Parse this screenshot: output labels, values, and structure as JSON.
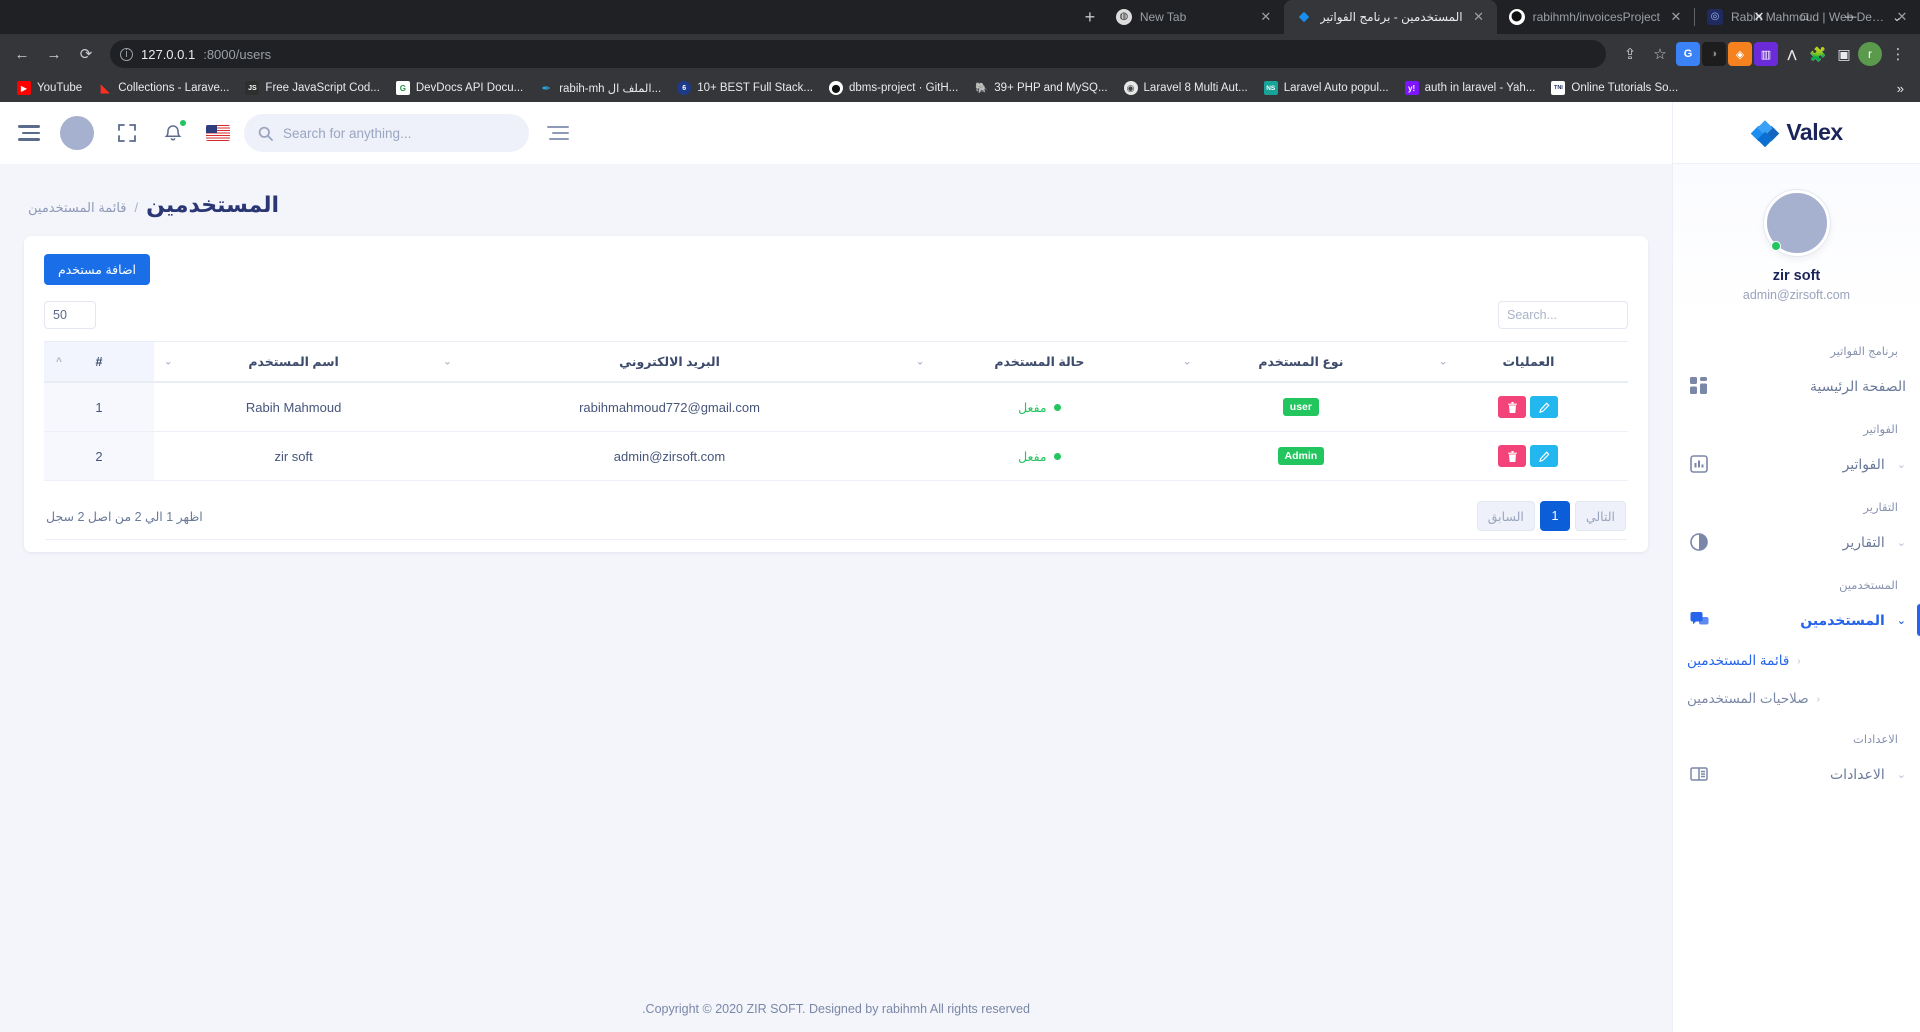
{
  "browser": {
    "tabs": [
      {
        "title": "Rabih Mahmoud | Web Developer",
        "favicon": "portfolio-icon",
        "active": false,
        "rtl": false
      },
      {
        "title": "rabihmh/invoicesProject",
        "favicon": "github-icon",
        "active": false,
        "rtl": false
      },
      {
        "title": "المستخدمين - برنامج الفواتير",
        "favicon": "valex-icon",
        "active": true,
        "rtl": true
      },
      {
        "title": "New Tab",
        "favicon": "chrome-icon",
        "active": false,
        "rtl": false
      }
    ],
    "new_tab_label": "+",
    "window_controls": {
      "minimize": "—",
      "maximize": "□",
      "close": "✕",
      "restore": "⌄"
    },
    "nav": {
      "back": "←",
      "forward": "→",
      "reload": "⟳"
    },
    "omnibox": {
      "info_glyph": "i",
      "host": "127.0.0.1",
      "rest": ":8000/users",
      "full_url": "127.0.0.1:8000/users"
    },
    "toolbar_right": {
      "share": "⇪",
      "bookmark_star": "☆",
      "profile_initial": "r",
      "menu": "⋮"
    },
    "extensions": [
      "translate-icon",
      "dark-reader-icon",
      "honey-icon",
      "colorzilla-icon",
      "lighthouse-icon",
      "puzzle-icon",
      "sidebar-icon"
    ],
    "bookmarks": [
      {
        "label": "YouTube",
        "icon": "youtube-icon",
        "color": "#ff0000",
        "glyph": "▶"
      },
      {
        "label": "Collections - Larave...",
        "icon": "laravel-icon",
        "color": "#ff2d20",
        "glyph": "L"
      },
      {
        "label": "Free JavaScript Cod...",
        "icon": "js-icon",
        "color": "#2f2f2f",
        "glyph": "JS"
      },
      {
        "label": "DevDocs API Docu...",
        "icon": "devdocs-icon",
        "color": "#ffffff",
        "glyph": "G"
      },
      {
        "label": "rabih-mh الملف ال...",
        "icon": "feather-icon",
        "color": "#1e90d6",
        "glyph": "✒"
      },
      {
        "label": "10+ BEST Full Stack...",
        "icon": "globe-icon",
        "color": "#2c6ebf",
        "glyph": "6"
      },
      {
        "label": "dbms-project · GitH...",
        "icon": "github-icon",
        "color": "#ffffff",
        "glyph": "G"
      },
      {
        "label": "39+ PHP and MySQ...",
        "icon": "php-icon",
        "color": "#2b3a67",
        "glyph": "🐘"
      },
      {
        "label": "Laravel 8 Multi Aut...",
        "icon": "site-icon",
        "color": "#e8e8e8",
        "glyph": "◉"
      },
      {
        "label": "Laravel Auto popul...",
        "icon": "nitro-icon",
        "color": "#17a398",
        "glyph": "NS"
      },
      {
        "label": "auth in laravel - Yah...",
        "icon": "yahoo-icon",
        "color": "#7b16ff",
        "glyph": "y!"
      },
      {
        "label": "Online Tutorials So...",
        "icon": "tni-icon",
        "color": "#ffffff",
        "glyph": "TNI"
      }
    ],
    "bookmarks_overflow": "»"
  },
  "app": {
    "brand": {
      "name": "Valex",
      "logo": "valex-diamond-logo"
    },
    "topbar": {
      "menu_icon": "hamburger-icon",
      "avatar": "user-avatar",
      "fullscreen_icon": "fullscreen-icon",
      "notifications_icon": "bell-icon",
      "language_flag": "us-flag-icon",
      "search_placeholder": "Search for anything...",
      "search_value": "",
      "search_icon": "search-icon",
      "filter_icon": "filter-lines-icon"
    },
    "profile": {
      "name": "zir soft",
      "email": "admin@zirsoft.com",
      "status": "online"
    },
    "sidebar": [
      {
        "type": "category",
        "label": "برنامج الفواتير"
      },
      {
        "type": "item",
        "label": "الصفحة الرئيسية",
        "icon": "dashboard-grid-icon",
        "active": false,
        "expandable": false
      },
      {
        "type": "category",
        "label": "الفواتير"
      },
      {
        "type": "item",
        "label": "الفواتير",
        "icon": "bar-chart-icon",
        "active": false,
        "expandable": true,
        "chevron": "⌄"
      },
      {
        "type": "category",
        "label": "التقارير"
      },
      {
        "type": "item",
        "label": "التقارير",
        "icon": "pie-chart-icon",
        "active": false,
        "expandable": true,
        "chevron": "⌄"
      },
      {
        "type": "category",
        "label": "المستخدمين"
      },
      {
        "type": "item",
        "label": "المستخدمين",
        "icon": "users-chat-icon",
        "active": true,
        "expandable": true,
        "chevron": "⌄"
      },
      {
        "type": "sub",
        "label": "قائمة المستخدمين",
        "chevron": "‹",
        "active": true
      },
      {
        "type": "sub",
        "label": "صلاحيات المستخدمين",
        "chevron": "‹",
        "active": false
      },
      {
        "type": "category",
        "label": "الاعدادات"
      },
      {
        "type": "item",
        "label": "الاعدادات",
        "icon": "book-icon",
        "active": false,
        "expandable": true,
        "chevron": "⌄"
      }
    ],
    "page": {
      "title": "المستخدمين",
      "breadcrumb": "قائمة المستخدمين",
      "breadcrumb_sep": "/"
    },
    "card": {
      "add_button": "اضافة مستخدم",
      "search_placeholder": "Search...",
      "search_value": "",
      "page_length": "50"
    },
    "table": {
      "columns": [
        {
          "key": "id",
          "label": "#",
          "sorter": "^"
        },
        {
          "key": "name",
          "label": "اسم المستخدم",
          "sorter": "⌄"
        },
        {
          "key": "email",
          "label": "البريد الالكتروني",
          "sorter": "⌄"
        },
        {
          "key": "state",
          "label": "حالة المستخدم",
          "sorter": "⌄"
        },
        {
          "key": "type",
          "label": "نوع المستخدم",
          "sorter": "⌄"
        },
        {
          "key": "ops",
          "label": "العمليات",
          "sorter": "⌄"
        }
      ],
      "rows": [
        {
          "id": "1",
          "name": "Rabih Mahmoud",
          "email": "rabihmahmoud772@gmail.com",
          "state": "مفعل",
          "type": "user",
          "type_color": "#22c55e",
          "delete_icon": "trash-icon",
          "edit_icon": "pencil-icon"
        },
        {
          "id": "2",
          "name": "zir soft",
          "email": "admin@zirsoft.com",
          "state": "مفعل",
          "type": "Admin",
          "type_color": "#22c55e",
          "delete_icon": "trash-icon",
          "edit_icon": "pencil-icon"
        }
      ],
      "info": "اظهر 1 الي 2 من اصل 2 سجل",
      "pagination": {
        "prev": "السابق",
        "pages": [
          "1"
        ],
        "next": "التالي",
        "current": "1"
      }
    },
    "footer": {
      "text_start": "Copyright © 2020",
      "link1": "ZIR SOFT",
      "text_mid": ". Designed by",
      "link2": "rabihmh",
      "text_end": "All rights reserved",
      "full": ".Copyright © 2020 ZIR SOFT. Designed by rabihmh All rights reserved"
    }
  },
  "colors": {
    "accent": "#2563eb",
    "primary_button": "#1a6fe8",
    "success": "#22c55e",
    "danger": "#f3447a",
    "info": "#23b7f0",
    "page_bg": "#f3f5fb",
    "title": "#2b3674"
  }
}
